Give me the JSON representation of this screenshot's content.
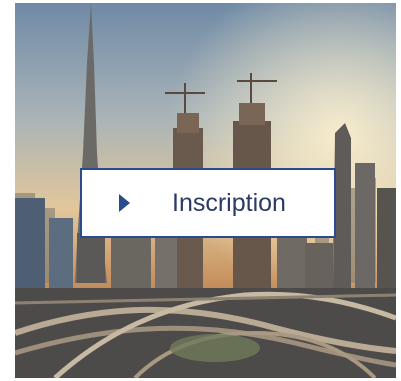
{
  "hero": {
    "image_icon": "city-skyline-image",
    "button_label": "Inscription",
    "button_icon": "play-triangle-icon",
    "accent_color": "#2b4b8f"
  }
}
